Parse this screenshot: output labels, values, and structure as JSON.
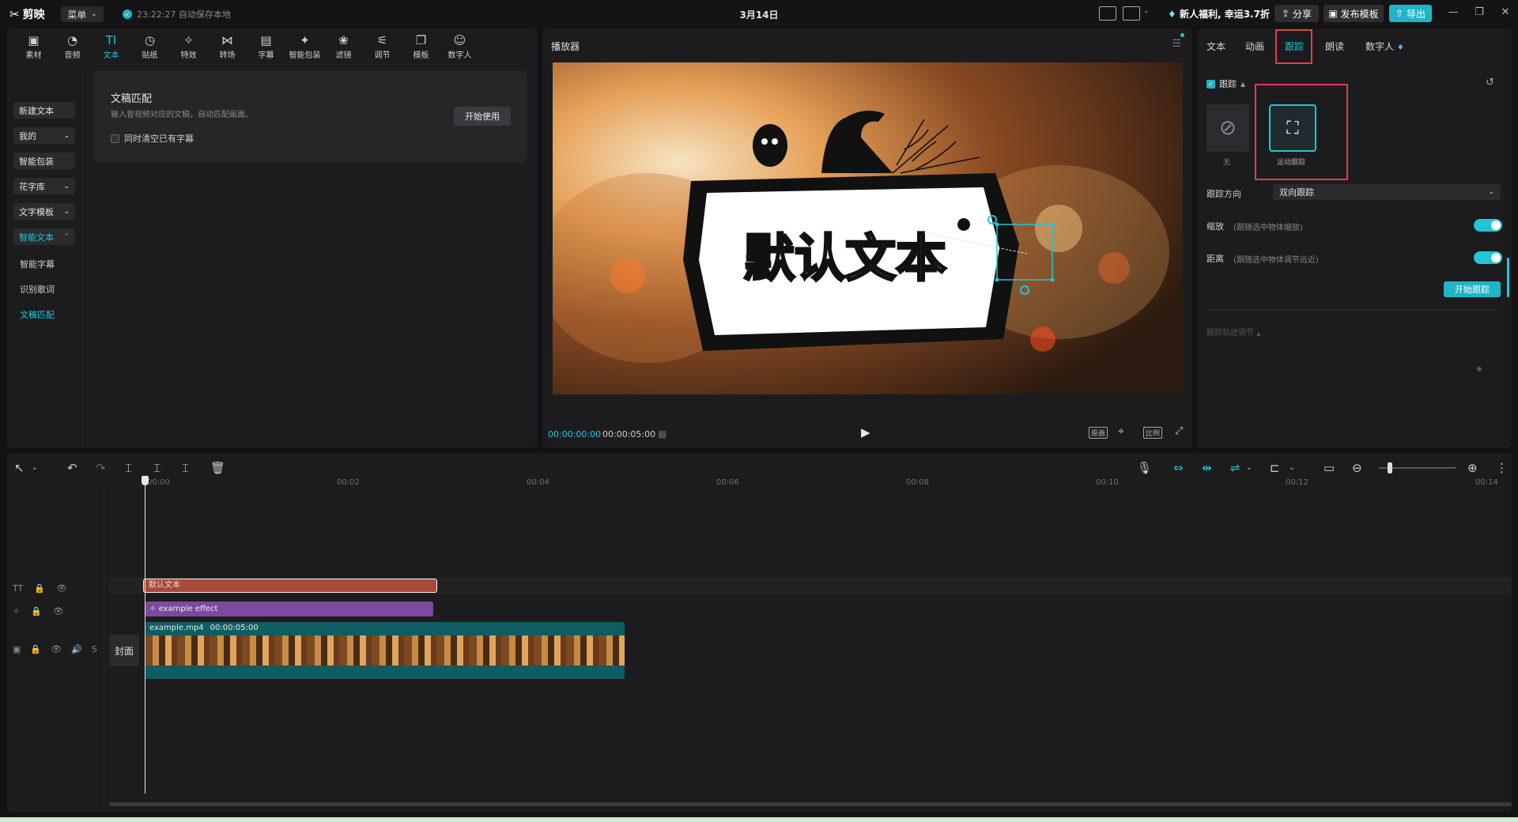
{
  "titlebar": {
    "app_name": "剪映",
    "menu_label": "菜单",
    "autosave_text": "23:22:27 自动保存本地",
    "project_title": "3月14日",
    "promo_text": "新人福利, 幸运3.7折",
    "share_label": "分享",
    "publish_label": "发布模板",
    "export_label": "导出"
  },
  "toolbar": {
    "items": [
      {
        "label": "素材",
        "icon": "▣"
      },
      {
        "label": "音频",
        "icon": "◔"
      },
      {
        "label": "文本",
        "icon": "TI"
      },
      {
        "label": "贴纸",
        "icon": "◷"
      },
      {
        "label": "特效",
        "icon": "✧"
      },
      {
        "label": "转场",
        "icon": "⋈"
      },
      {
        "label": "字幕",
        "icon": "▤"
      },
      {
        "label": "智能包装",
        "icon": "✦"
      },
      {
        "label": "滤镜",
        "icon": "❀"
      },
      {
        "label": "调节",
        "icon": "⚟"
      },
      {
        "label": "模板",
        "icon": "❐"
      },
      {
        "label": "数字人",
        "icon": "☺"
      }
    ]
  },
  "sidebar": {
    "new_text": "新建文本",
    "mine": "我的",
    "smart_pack": "智能包装",
    "font_lib": "花字库",
    "text_template": "文字模板",
    "smart_text": "智能文本",
    "smart_caption": "智能字幕",
    "lyrics": "识别歌词",
    "script_match": "文稿匹配"
  },
  "card": {
    "title": "文稿匹配",
    "desc": "输入音视频对应的文稿，自动匹配画面。",
    "start_btn": "开始使用",
    "clear_label": "同时清空已有字幕"
  },
  "player": {
    "title": "播放器",
    "overlay_text": "默认文本",
    "current_time": "00:00:00:00",
    "duration": "00:00:05:00",
    "ratio_label": "原画",
    "aspect_label": "比例"
  },
  "right": {
    "tabs": [
      "文本",
      "动画",
      "跟踪",
      "朗读",
      "数字人"
    ],
    "track_label": "跟踪",
    "opt_none": "无",
    "opt_motion": "运动跟踪",
    "direction_label": "跟踪方向",
    "direction_value": "双向跟踪",
    "scale_label": "缩放",
    "scale_hint": "(跟随选中物体缩放)",
    "distance_label": "距离",
    "distance_hint": "(跟随选中物体调节远近)",
    "start_track": "开始跟踪",
    "track_adjust": "跟踪轨迹调节"
  },
  "timeline": {
    "ruler": [
      "00:00",
      "00:02",
      "00:04",
      "00:06",
      "00:08",
      "00:10",
      "00:12",
      "00:14"
    ],
    "text_clip": "默认文本",
    "effect_clip": "example effect",
    "video_clip_name": "example.mp4",
    "video_clip_duration": "00:00:05:00",
    "cover_label": "封面",
    "mute_label": "S"
  },
  "colors": {
    "accent": "#21c6d8",
    "text_clip": "#a74a3a",
    "effect_clip": "#7b4a9e",
    "video_clip": "#0f5d62",
    "highlight_box": "#e0404a"
  }
}
